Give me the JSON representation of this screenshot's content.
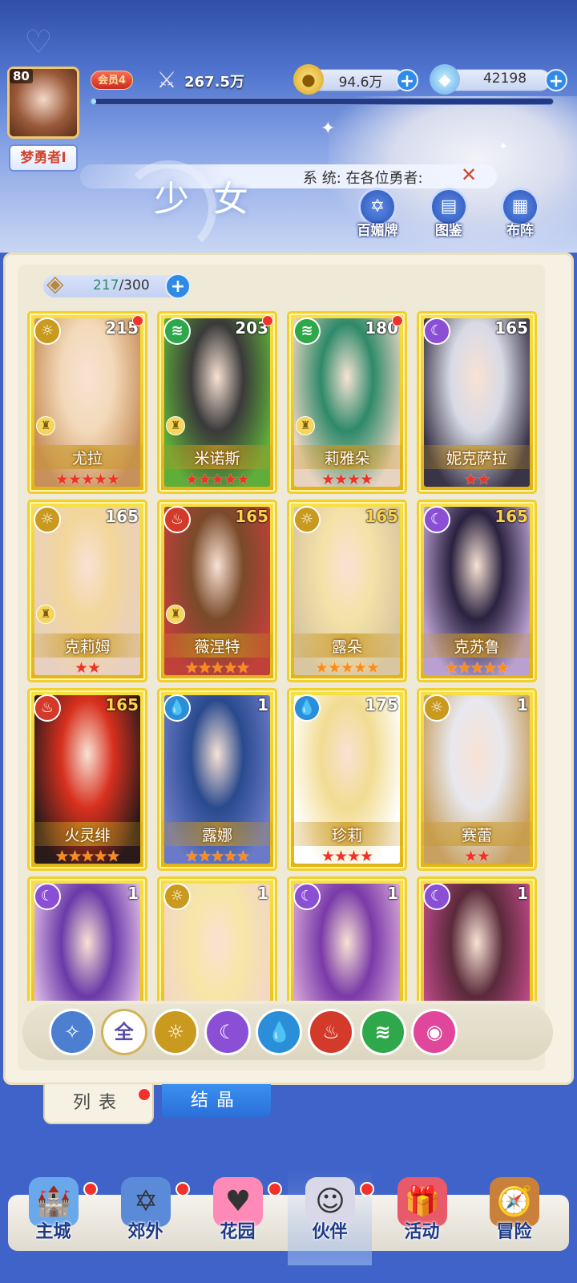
{
  "header": {
    "player_level": "80",
    "player_name": "梦勇者I",
    "vip_label": "会员4",
    "power_value": "267.5万",
    "gold_value": "94.6万",
    "gems_value": "42198",
    "exp_progress": 0.01,
    "system_message": "系 统: 在各位勇者:",
    "section_title": "少女",
    "buttons": [
      {
        "label": "百媚牌",
        "icon": "card-deck-icon"
      },
      {
        "label": "图鉴",
        "icon": "book-icon"
      },
      {
        "label": "布阵",
        "icon": "grid-icon"
      }
    ]
  },
  "roster": {
    "count_current": "217",
    "count_max": "/300",
    "cards": [
      {
        "name": "尤拉",
        "level": "215",
        "element": "light",
        "stars": 5,
        "star_color": "red",
        "dot": true,
        "chess": true,
        "level_gold": false
      },
      {
        "name": "米诺斯",
        "level": "203",
        "element": "wind",
        "stars": 5,
        "star_color": "red",
        "dot": true,
        "chess": true,
        "level_gold": false
      },
      {
        "name": "莉雅朵",
        "level": "180",
        "element": "wind",
        "stars": 4,
        "star_color": "red",
        "dot": true,
        "chess": true,
        "level_gold": false
      },
      {
        "name": "妮克萨拉",
        "level": "165",
        "element": "dark",
        "stars": 2,
        "star_color": "red",
        "dot": false,
        "chess": false,
        "level_gold": false
      },
      {
        "name": "克莉姆",
        "level": "165",
        "element": "light",
        "stars": 2,
        "star_color": "red",
        "dot": false,
        "chess": true,
        "level_gold": false
      },
      {
        "name": "薇涅特",
        "level": "165",
        "element": "fire",
        "stars": 5,
        "star_color": "orange",
        "dot": false,
        "chess": true,
        "level_gold": true
      },
      {
        "name": "露朵",
        "level": "165",
        "element": "light",
        "stars": 5,
        "star_color": "orange",
        "dot": false,
        "chess": false,
        "level_gold": true
      },
      {
        "name": "克苏鲁",
        "level": "165",
        "element": "dark",
        "stars": 5,
        "star_color": "orange",
        "dot": false,
        "chess": false,
        "level_gold": true
      },
      {
        "name": "火灵绯",
        "level": "165",
        "element": "fire",
        "stars": 5,
        "star_color": "orange",
        "dot": false,
        "chess": false,
        "level_gold": true
      },
      {
        "name": "露娜",
        "level": "1",
        "element": "water",
        "stars": 5,
        "star_color": "orange",
        "dot": false,
        "chess": false,
        "level_gold": false
      },
      {
        "name": "珍莉",
        "level": "175",
        "element": "water",
        "stars": 4,
        "star_color": "red",
        "dot": false,
        "chess": false,
        "level_gold": false
      },
      {
        "name": "赛蕾",
        "level": "1",
        "element": "light",
        "stars": 2,
        "star_color": "red",
        "dot": false,
        "chess": false,
        "level_gold": false
      },
      {
        "name": "",
        "level": "1",
        "element": "dark",
        "stars": 0,
        "star_color": "red",
        "dot": false,
        "chess": false,
        "level_gold": false
      },
      {
        "name": "",
        "level": "1",
        "element": "light",
        "stars": 0,
        "star_color": "red",
        "dot": false,
        "chess": false,
        "level_gold": false
      },
      {
        "name": "",
        "level": "1",
        "element": "dark",
        "stars": 0,
        "star_color": "red",
        "dot": false,
        "chess": false,
        "level_gold": false
      },
      {
        "name": "",
        "level": "1",
        "element": "dark",
        "stars": 0,
        "star_color": "red",
        "dot": false,
        "chess": false,
        "level_gold": false
      }
    ]
  },
  "filters": [
    {
      "key": "special",
      "label": "",
      "icon": "winged-star-icon"
    },
    {
      "key": "all",
      "label": "全",
      "icon": "all-icon"
    },
    {
      "key": "light",
      "label": "",
      "icon": "sun-icon"
    },
    {
      "key": "dark",
      "label": "",
      "icon": "moon-icon"
    },
    {
      "key": "water",
      "label": "",
      "icon": "water-drop-icon"
    },
    {
      "key": "fire",
      "label": "",
      "icon": "flame-icon"
    },
    {
      "key": "wind",
      "label": "",
      "icon": "wind-icon"
    },
    {
      "key": "spirit",
      "label": "",
      "icon": "orb-icon"
    }
  ],
  "tabs": {
    "list_label": "列表",
    "crystal_label": "结晶"
  },
  "nav": [
    {
      "label": "主城",
      "icon": "castle-icon",
      "dot": true,
      "active": false
    },
    {
      "label": "郊外",
      "icon": "portal-icon",
      "dot": true,
      "active": false
    },
    {
      "label": "花园",
      "icon": "heart-icon",
      "dot": true,
      "active": false
    },
    {
      "label": "伙伴",
      "icon": "partner-portrait-icon",
      "dot": true,
      "active": true
    },
    {
      "label": "活动",
      "icon": "gift-box-icon",
      "dot": false,
      "active": false
    },
    {
      "label": "冒险",
      "icon": "compass-icon",
      "dot": false,
      "active": false
    }
  ],
  "colors": {
    "light": "#c99a1e",
    "dark": "#8b4fd6",
    "water": "#2a8fd8",
    "fire": "#d33a2a",
    "wind": "#2ea84a",
    "spirit": "#e0479a",
    "special": "#4c7fd0"
  }
}
